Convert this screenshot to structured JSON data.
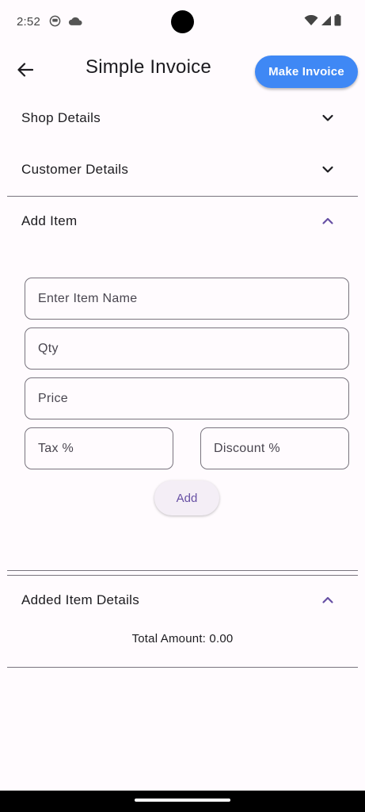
{
  "status_bar": {
    "time": "2:52",
    "icons": [
      "notification-icon",
      "cloud-icon",
      "wifi-icon",
      "cellular-icon",
      "battery-icon"
    ]
  },
  "app_bar": {
    "title": "Simple Invoice",
    "make_invoice_label": "Make Invoice",
    "back_icon": "arrow-back-icon",
    "accent_color": "#3f88f5"
  },
  "sections": {
    "shop_details": {
      "label": "Shop Details",
      "expanded": false
    },
    "customer_details": {
      "label": "Customer Details",
      "expanded": false
    },
    "add_item": {
      "label": "Add Item",
      "expanded": true
    },
    "added_item_details": {
      "label": "Added Item Details",
      "expanded": true
    }
  },
  "add_item_form": {
    "item_name_placeholder": "Enter Item Name",
    "qty_placeholder": "Qty",
    "price_placeholder": "Price",
    "tax_placeholder": "Tax %",
    "discount_placeholder": "Discount %",
    "add_button_label": "Add"
  },
  "added_items": {
    "total_amount_text": "Total Amount: 0.00"
  },
  "colors": {
    "primary_purple": "#6750a4",
    "background": "#fffbfe",
    "outline": "#79747e"
  }
}
